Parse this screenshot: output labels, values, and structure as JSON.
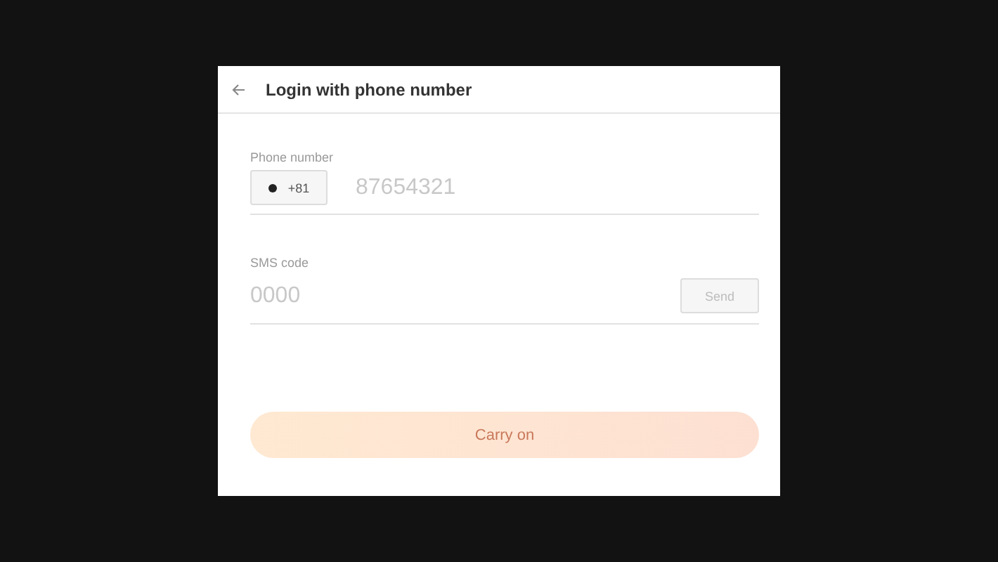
{
  "header": {
    "title": "Login with phone number"
  },
  "phone": {
    "label": "Phone number",
    "country_code": "+81",
    "placeholder": "87654321"
  },
  "sms": {
    "label": "SMS code",
    "placeholder": "0000",
    "send_button": {
      "label": "Send",
      "disabled": true
    }
  },
  "submit_button": {
    "label": "Carry on",
    "disabled": true
  }
}
